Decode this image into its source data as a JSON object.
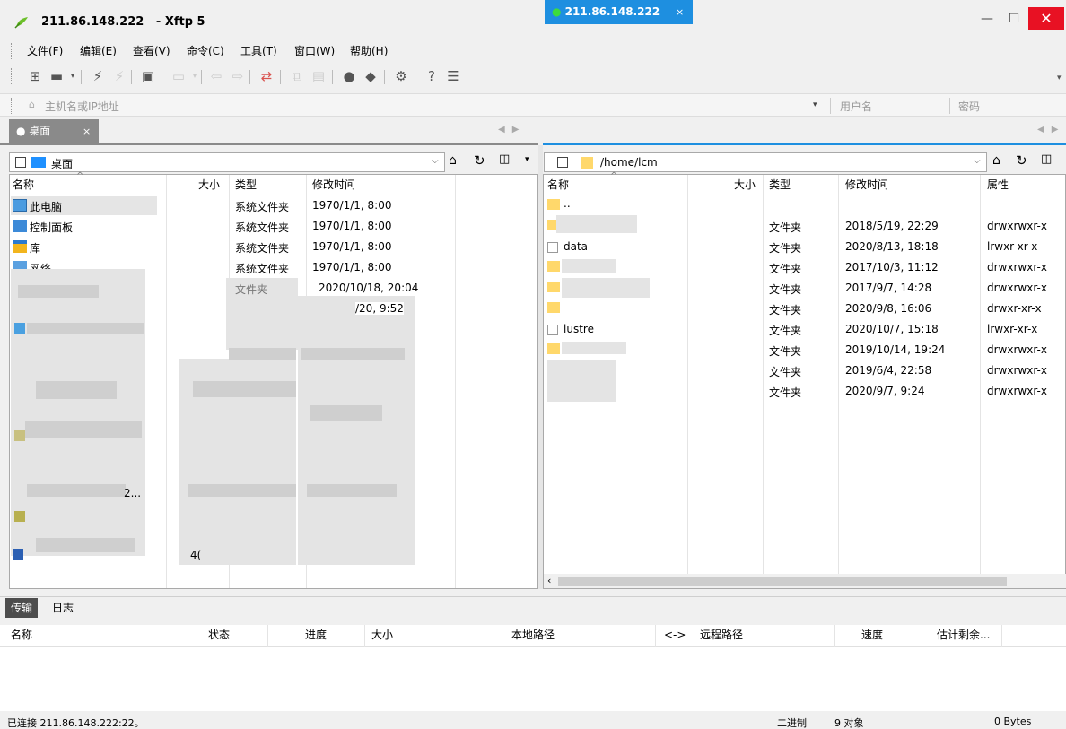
{
  "window": {
    "title": "211.86.148.222   - Xftp 5",
    "minimize": "—",
    "maximize": "☐",
    "close": "✕"
  },
  "menu": [
    "文件(F)",
    "编辑(E)",
    "查看(V)",
    "命令(C)",
    "工具(T)",
    "窗口(W)",
    "帮助(H)"
  ],
  "addressbar": {
    "host_placeholder": "主机名或IP地址",
    "user_placeholder": "用户名",
    "password_placeholder": "密码"
  },
  "tabs": {
    "local": "桌面",
    "remote": "211.86.148.222"
  },
  "local": {
    "path": "桌面",
    "columns": [
      "名称",
      "大小",
      "类型",
      "修改时间"
    ],
    "rows": [
      {
        "name": "此电脑",
        "type": "系统文件夹",
        "mtime": "1970/1/1, 8:00"
      },
      {
        "name": "控制面板",
        "type": "系统文件夹",
        "mtime": "1970/1/1, 8:00"
      },
      {
        "name": "库",
        "type": "系统文件夹",
        "mtime": "1970/1/1, 8:00"
      },
      {
        "name": "网络",
        "type": "系统文件夹",
        "mtime": "1970/1/1, 8:00"
      },
      {
        "name": "",
        "type": "文件夹",
        "mtime": "2020/10/18, 20:04"
      },
      {
        "name": "",
        "type": "",
        "mtime": "/20, 9:52"
      }
    ],
    "fragment_size": "4(",
    "fragment_name": "2..."
  },
  "remote": {
    "path": "/home/lcm",
    "columns": [
      "名称",
      "大小",
      "类型",
      "修改时间",
      "属性"
    ],
    "rows": [
      {
        "name": "..",
        "type": "",
        "mtime": "",
        "attr": ""
      },
      {
        "name": "",
        "type": "文件夹",
        "mtime": "2018/5/19, 22:29",
        "attr": "drwxrwxr-x"
      },
      {
        "name": "data",
        "type": "文件夹",
        "mtime": "2020/8/13, 18:18",
        "attr": "lrwxr-xr-x"
      },
      {
        "name": "",
        "type": "文件夹",
        "mtime": "2017/10/3, 11:12",
        "attr": "drwxrwxr-x"
      },
      {
        "name": "",
        "type": "文件夹",
        "mtime": "2017/9/7, 14:28",
        "attr": "drwxrwxr-x"
      },
      {
        "name": "",
        "type": "文件夹",
        "mtime": "2020/9/8, 16:06",
        "attr": "drwxr-xr-x"
      },
      {
        "name": "lustre",
        "type": "文件夹",
        "mtime": "2020/10/7, 15:18",
        "attr": "lrwxr-xr-x"
      },
      {
        "name": "",
        "type": "文件夹",
        "mtime": "2019/10/14, 19:24",
        "attr": "drwxrwxr-x"
      },
      {
        "name": "",
        "type": "文件夹",
        "mtime": "2019/6/4, 22:58",
        "attr": "drwxrwxr-x"
      },
      {
        "name": "",
        "type": "文件夹",
        "mtime": "2020/9/7, 9:24",
        "attr": "drwxrwxr-x"
      }
    ]
  },
  "transfer": {
    "tabs": [
      "传输",
      "日志"
    ],
    "columns": [
      "名称",
      "状态",
      "进度",
      "大小",
      "本地路径",
      "<->",
      "远程路径",
      "速度",
      "估计剩余..."
    ]
  },
  "status": {
    "connection": "已连接 211.86.148.222:22。",
    "mode": "二进制",
    "objects": "9 对象",
    "bytes": "0 Bytes"
  },
  "colors": {
    "remote_tab": "#1e8fe0",
    "local_tab": "#8a8a8a",
    "close_button": "#e81123",
    "folder": "#ffd86b"
  }
}
